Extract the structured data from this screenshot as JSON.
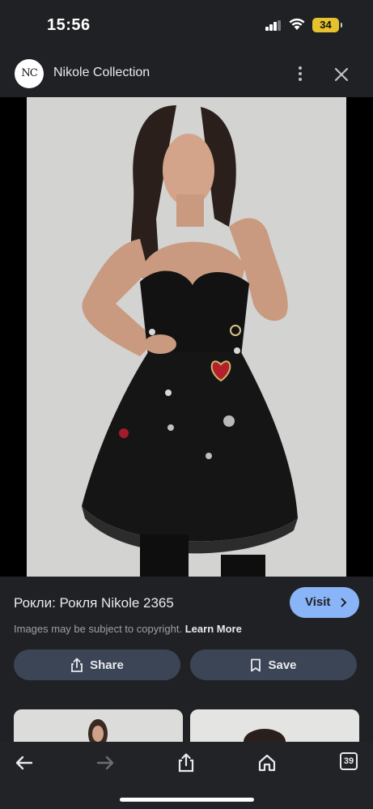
{
  "status_bar": {
    "time": "15:56",
    "battery": "34"
  },
  "header": {
    "logo_text": "NC",
    "site_name": "Nikole Collection"
  },
  "image": {
    "subject": "product-photo-black-dress"
  },
  "info": {
    "title": "Рокли: Рокля Nikole 2365",
    "visit_label": "Visit",
    "copyright": "Images may be subject to copyright.",
    "learn_more": "Learn More",
    "share_label": "Share",
    "save_label": "Save"
  },
  "bottom_bar": {
    "tab_count": "39"
  },
  "colors": {
    "accent": "#8ab4f8",
    "background": "#202124",
    "button": "#3c4556",
    "battery": "#e6c22e"
  }
}
